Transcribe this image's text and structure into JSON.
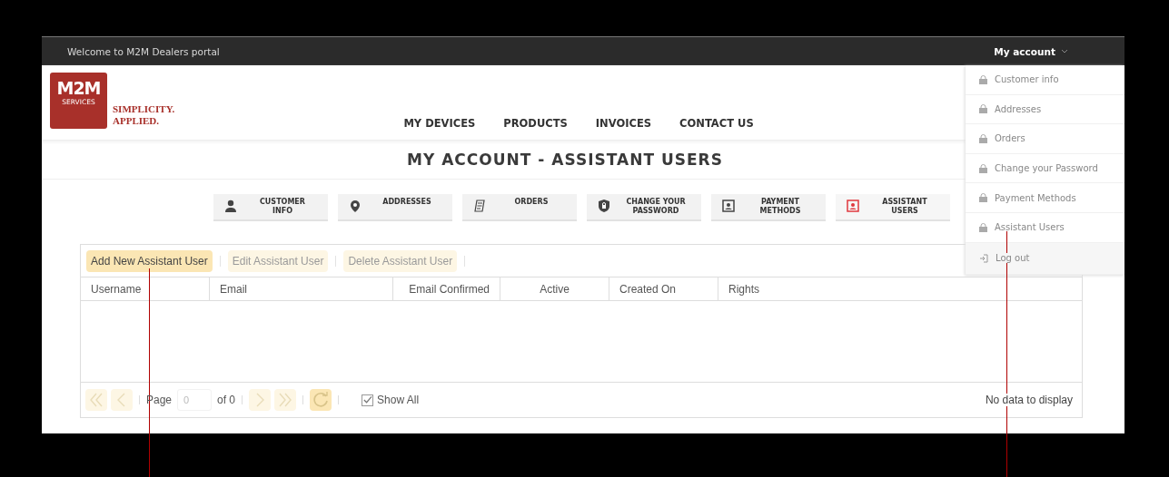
{
  "top_bar": {
    "welcome": "Welcome to M2M Dealers portal",
    "account_menu": "My account"
  },
  "logo": {
    "mark": "M2M",
    "sub": "SERVICES",
    "tagline_1": "SIMPLICITY.",
    "tagline_2": "APPLIED."
  },
  "nav": [
    "MY DEVICES",
    "PRODUCTS",
    "INVOICES",
    "CONTACT US"
  ],
  "page_title": "MY ACCOUNT - ASSISTANT USERS",
  "tabs": [
    {
      "kind": "person",
      "label": "CUSTOMER INFO",
      "selected": false
    },
    {
      "kind": "pin",
      "label": "ADDRESSES",
      "selected": false
    },
    {
      "kind": "receipt",
      "label": "ORDERS",
      "selected": false
    },
    {
      "kind": "shield",
      "label": "CHANGE YOUR PASSWORD",
      "selected": false
    },
    {
      "kind": "card",
      "label": "PAYMENT METHODS",
      "selected": false
    },
    {
      "kind": "card",
      "label": "ASSISTANT USERS",
      "selected": true
    }
  ],
  "toolbar": [
    {
      "label": "Add New Assistant User",
      "disabled": false
    },
    {
      "label": "Edit Assistant User",
      "disabled": true
    },
    {
      "label": "Delete Assistant User",
      "disabled": true
    }
  ],
  "table": {
    "columns": [
      "Username",
      "Email",
      "Email Confirmed",
      "Active",
      "Created On",
      "Rights"
    ]
  },
  "pager": {
    "page_label": "Page",
    "page_value": "0",
    "of": "of 0",
    "show_all": {
      "label": "Show All",
      "checked": true
    },
    "status": "No data to display"
  },
  "account_dropdown": [
    {
      "kind": "lock",
      "label": "Customer info"
    },
    {
      "kind": "lock",
      "label": "Addresses"
    },
    {
      "kind": "lock",
      "label": "Orders"
    },
    {
      "kind": "lock",
      "label": "Change your Password"
    },
    {
      "kind": "lock",
      "label": "Payment Methods"
    },
    {
      "kind": "lock",
      "label": "Assistant Users"
    },
    {
      "kind": "logout",
      "label": "Log out"
    }
  ]
}
